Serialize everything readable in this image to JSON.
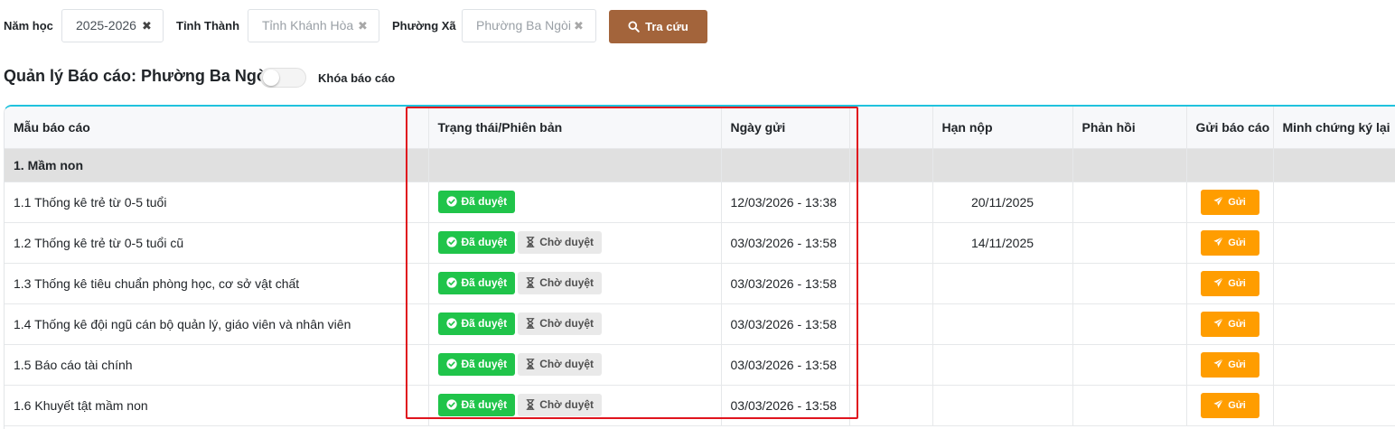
{
  "filters": {
    "school_year": {
      "label": "Năm học",
      "value": "2025-2026"
    },
    "province": {
      "label": "Tỉnh Thành",
      "value": "Tỉnh Khánh Hòa"
    },
    "ward": {
      "label": "Phường Xã",
      "value": "Phường Ba Ngòi"
    },
    "clear_glyph": "✖",
    "search_label": "Tra cứu"
  },
  "header": {
    "title": "Quản lý Báo cáo: Phường Ba Ngòi",
    "lock_label": "Khóa báo cáo",
    "lock_enabled": false
  },
  "table": {
    "columns": [
      "Mẫu báo cáo",
      "Trạng thái/Phiên bản",
      "Ngày gửi",
      "",
      "Hạn nộp",
      "Phản hồi",
      "Gửi báo cáo",
      "Minh chứng ký lại"
    ],
    "group": "1. Mầm non",
    "rows": [
      {
        "name": "1.1 Thống kê trẻ từ 0-5 tuổi",
        "approved": "Đã duyệt",
        "pending": "",
        "sent": "12/03/2026 - 13:38",
        "deadline": "20/11/2025",
        "send": "Gửi"
      },
      {
        "name": "1.2 Thống kê trẻ từ 0-5 tuổi cũ",
        "approved": "Đã duyệt",
        "pending": "Chờ duyệt",
        "sent": "03/03/2026 - 13:58",
        "deadline": "14/11/2025",
        "send": "Gửi"
      },
      {
        "name": "1.3 Thống kê tiêu chuẩn phòng học, cơ sở vật chất",
        "approved": "Đã duyệt",
        "pending": "Chờ duyệt",
        "sent": "03/03/2026 - 13:58",
        "deadline": "",
        "send": "Gửi"
      },
      {
        "name": "1.4 Thống kê đội ngũ cán bộ quản lý, giáo viên và nhân viên",
        "approved": "Đã duyệt",
        "pending": "Chờ duyệt",
        "sent": "03/03/2026 - 13:58",
        "deadline": "",
        "send": "Gửi"
      },
      {
        "name": "1.5 Báo cáo tài chính",
        "approved": "Đã duyệt",
        "pending": "Chờ duyệt",
        "sent": "03/03/2026 - 13:58",
        "deadline": "",
        "send": "Gửi"
      },
      {
        "name": "1.6 Khuyết tật mầm non",
        "approved": "Đã duyệt",
        "pending": "Chờ duyệt",
        "sent": "03/03/2026 - 13:58",
        "deadline": "",
        "send": "Gửi"
      }
    ]
  },
  "colors": {
    "search_button": "#a3643b",
    "approved": "#20c44a",
    "pending": "#e9e9e9",
    "send_button": "#ff9d00",
    "table_accent": "#20c2dd",
    "highlight": "#e0141e"
  },
  "icons": {
    "search": "search-icon",
    "approved": "check-circle-icon",
    "pending": "hourglass-icon",
    "send": "paper-plane-icon",
    "clear": "close-icon"
  }
}
